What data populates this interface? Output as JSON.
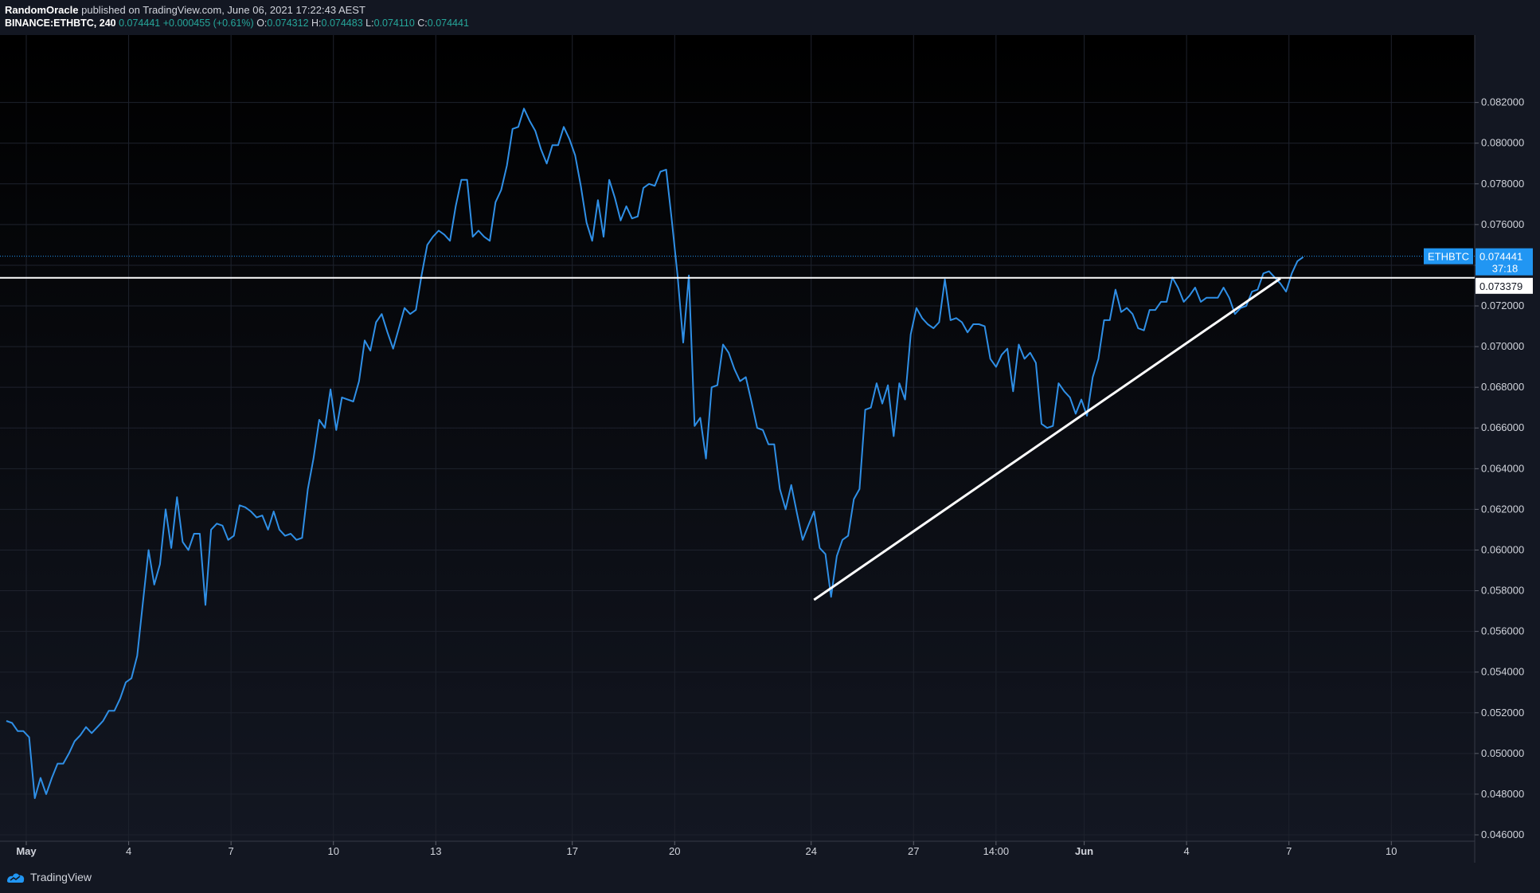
{
  "header": {
    "author": "RandomOracle",
    "published_text": "published on TradingView.com, June 06, 2021 17:22:43 AEST",
    "symbol": "BINANCE:ETHBTC, 240",
    "last": "0.074441",
    "change": "+0.000455 (+0.61%)",
    "open_label": "O:",
    "open": "0.074312",
    "high_label": "H:",
    "high": "0.074483",
    "low_label": "L:",
    "low": "0.074110",
    "close_label": "C:",
    "close": "0.074441"
  },
  "footer": {
    "brand": "TradingView",
    "logo_icon": "tradingview-logo-icon"
  },
  "colors": {
    "background": "#131722",
    "line": "#2f8fe6",
    "price_tag": "#2196f3",
    "drawing": "#ffffff"
  },
  "chart_data": {
    "type": "line",
    "title": "",
    "xlabel": "",
    "ylabel": "",
    "ylim": [
      0.046,
      0.0832
    ],
    "y_ticks": [
      "0.046000",
      "0.048000",
      "0.050000",
      "0.052000",
      "0.054000",
      "0.056000",
      "0.058000",
      "0.060000",
      "0.062000",
      "0.064000",
      "0.066000",
      "0.068000",
      "0.070000",
      "0.072000",
      "0.074000",
      "0.076000",
      "0.078000",
      "0.080000",
      "0.082000"
    ],
    "x_ticks": [
      {
        "label": "May",
        "t": 3.5
      },
      {
        "label": "4",
        "t": 21.5
      },
      {
        "label": "7",
        "t": 39.5
      },
      {
        "label": "10",
        "t": 57.5
      },
      {
        "label": "13",
        "t": 75.5
      },
      {
        "label": "17",
        "t": 99.5
      },
      {
        "label": "20",
        "t": 117.5
      },
      {
        "label": "24",
        "t": 141.5
      },
      {
        "label": "27",
        "t": 159.5
      },
      {
        "label": "14:00",
        "t": 174
      },
      {
        "label": "Jun",
        "t": 189.5
      },
      {
        "label": "4",
        "t": 207.5
      },
      {
        "label": "7",
        "t": 225.5
      },
      {
        "label": "10",
        "t": 243.5
      }
    ],
    "x_bold_ticks": [
      "May",
      "Jun"
    ],
    "x_range": [
      -1,
      254.5
    ],
    "grid": true,
    "series": [
      {
        "name": "ETHBTC",
        "values": [
          0.0516,
          0.0515,
          0.0511,
          0.0511,
          0.0508,
          0.0478,
          0.0488,
          0.048,
          0.0488,
          0.0495,
          0.0495,
          0.05,
          0.0506,
          0.0509,
          0.0513,
          0.051,
          0.0513,
          0.0516,
          0.0521,
          0.0521,
          0.0527,
          0.0535,
          0.0537,
          0.0548,
          0.0574,
          0.06,
          0.0583,
          0.0593,
          0.062,
          0.0601,
          0.0626,
          0.0604,
          0.06,
          0.0608,
          0.0608,
          0.0573,
          0.061,
          0.0613,
          0.0612,
          0.0605,
          0.0607,
          0.0622,
          0.0621,
          0.0619,
          0.0616,
          0.0617,
          0.061,
          0.0619,
          0.061,
          0.0607,
          0.0608,
          0.0605,
          0.0606,
          0.063,
          0.0645,
          0.0664,
          0.066,
          0.0679,
          0.0659,
          0.0675,
          0.0674,
          0.0673,
          0.0683,
          0.0703,
          0.0698,
          0.0712,
          0.0716,
          0.0707,
          0.0699,
          0.0709,
          0.0719,
          0.0716,
          0.0718,
          0.0735,
          0.075,
          0.0754,
          0.0757,
          0.0755,
          0.0752,
          0.0769,
          0.0782,
          0.0782,
          0.0754,
          0.0757,
          0.0754,
          0.0752,
          0.0771,
          0.0777,
          0.0789,
          0.0807,
          0.0808,
          0.0817,
          0.0811,
          0.0806,
          0.0797,
          0.079,
          0.0799,
          0.0799,
          0.0808,
          0.0802,
          0.0794,
          0.0779,
          0.0761,
          0.0752,
          0.0772,
          0.0754,
          0.0782,
          0.0773,
          0.0762,
          0.0769,
          0.0763,
          0.0764,
          0.0778,
          0.078,
          0.0779,
          0.0786,
          0.0787,
          0.0762,
          0.0735,
          0.0702,
          0.0735,
          0.0661,
          0.0665,
          0.0645,
          0.068,
          0.0681,
          0.0701,
          0.0697,
          0.0689,
          0.0683,
          0.0685,
          0.0673,
          0.066,
          0.0659,
          0.0652,
          0.0652,
          0.063,
          0.062,
          0.0632,
          0.0618,
          0.0605,
          0.0612,
          0.0619,
          0.0601,
          0.0598,
          0.0577,
          0.0597,
          0.0605,
          0.0607,
          0.0625,
          0.063,
          0.0669,
          0.067,
          0.0682,
          0.0672,
          0.0681,
          0.0656,
          0.0682,
          0.0674,
          0.0706,
          0.0719,
          0.0714,
          0.0711,
          0.0709,
          0.0712,
          0.0733,
          0.0713,
          0.0714,
          0.0712,
          0.0707,
          0.0711,
          0.0711,
          0.071,
          0.0694,
          0.069,
          0.0696,
          0.0699,
          0.0678,
          0.0701,
          0.0694,
          0.0697,
          0.0692,
          0.0662,
          0.066,
          0.0661,
          0.0682,
          0.0678,
          0.0675,
          0.0667,
          0.0674,
          0.0666,
          0.0685,
          0.0694,
          0.0713,
          0.0713,
          0.0728,
          0.0717,
          0.0719,
          0.0716,
          0.0709,
          0.0708,
          0.0718,
          0.0718,
          0.0722,
          0.0722,
          0.0734,
          0.0729,
          0.0722,
          0.0725,
          0.0729,
          0.0722,
          0.0724,
          0.0724,
          0.0724,
          0.0729,
          0.0724,
          0.0716,
          0.0719,
          0.072,
          0.0727,
          0.0728,
          0.0736,
          0.0737,
          0.0734,
          0.0731,
          0.0727,
          0.0736,
          0.0742,
          0.0744
        ]
      }
    ],
    "horizontal_line": 0.073379,
    "trend_line": {
      "from": {
        "t": 142,
        "y": 0.05755
      },
      "to": {
        "t": 224,
        "y": 0.07335
      }
    },
    "last_price_tag": {
      "symbol": "ETHBTC",
      "value": "0.074441",
      "countdown": "37:18",
      "y": 0.074441
    },
    "hline_tag": {
      "value": "0.073379"
    }
  }
}
